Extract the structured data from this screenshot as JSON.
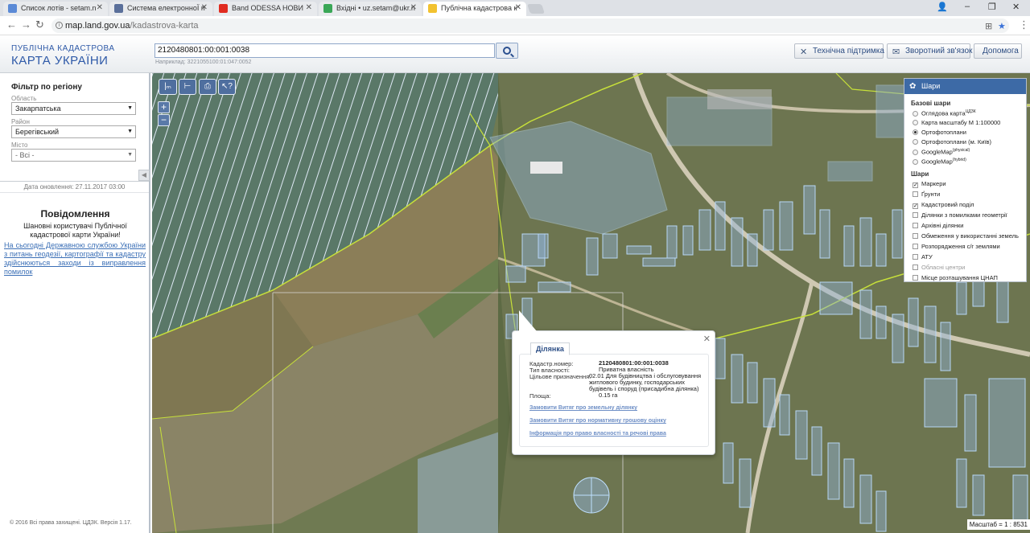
{
  "browser": {
    "tabs": [
      {
        "title": "Список лотів - setam.n",
        "favicon_color": "#5b8ad6"
      },
      {
        "title": "Система електронноЇ п",
        "favicon_color": "#5a6f9a"
      },
      {
        "title": "Band ODESSA НОВИ",
        "favicon_color": "#e02b20"
      },
      {
        "title": "Вхідні • uz.setam@ukr.n",
        "favicon_color": "#3aa757"
      },
      {
        "title": "Публічна кадастрова к",
        "favicon_color": "#f2c230"
      }
    ],
    "url_host": "map.land.gov.ua",
    "url_path": "/kadastrova-karta"
  },
  "header": {
    "logo_line1": "ПУБЛІЧНА КАДАСТРОВА",
    "logo_line2": "КАРТА УКРАЇНИ",
    "search_value": "2120480801:00:001:0038",
    "search_example": "Наприклад: 3221055100:01:047:0052",
    "buttons": {
      "support": "Технічна підтримка",
      "feedback": "Зворотний зв'язок",
      "help": "Допомога"
    }
  },
  "sidebar": {
    "filter_title": "Фільтр по регіону",
    "region_label": "Область",
    "region_value": "Закарпатська",
    "district_label": "Район",
    "district_value": "Берегівський",
    "city_label": "Місто",
    "city_value": "- Всі -",
    "update_date": "Дата оновлення: 27.11.2017 03:00",
    "notice_title": "Повідомлення",
    "notice_text": "Шановні користувачі Публічної кадастрової карти України!",
    "notice_link": "На сьогодні Державною службою України з питань геодезії, картографії та кадастру здійснюються заходи із виправлення помилок",
    "copyright": "© 2016 Всі права захищені. ЦДЗК. Версія 1.17."
  },
  "map": {
    "scale_text": "Масштаб = 1 : 8531",
    "tool_icons": [
      "ruler-line-icon",
      "ruler-area-icon",
      "print-icon",
      "info-cursor-icon"
    ]
  },
  "layers_panel": {
    "title": "Шари",
    "base_title": "Базові шари",
    "base_layers": [
      {
        "label": "Оглядова карта",
        "sup": "ЦДЗК",
        "selected": false
      },
      {
        "label": "Карта масштабу М 1:100000",
        "sup": "",
        "selected": false
      },
      {
        "label": "Ортофотоплани",
        "sup": "",
        "selected": true
      },
      {
        "label": "Ортофотоплани (м. Київ)",
        "sup": "",
        "selected": false
      },
      {
        "label": "GoogleMap",
        "sup": "(physical)",
        "selected": false
      },
      {
        "label": "GoogleMap",
        "sup": "(hybrid)",
        "selected": false
      }
    ],
    "overlay_title": "Шари",
    "overlay_layers": [
      {
        "label": "Маркери",
        "checked": true,
        "disabled": false
      },
      {
        "label": "Ґрунти",
        "checked": false,
        "disabled": false
      },
      {
        "label": "Кадастровий поділ",
        "checked": true,
        "disabled": false
      },
      {
        "label": "Ділянки з помилками геометрії",
        "checked": false,
        "disabled": false
      },
      {
        "label": "Архівні ділянки",
        "checked": false,
        "disabled": false
      },
      {
        "label": "Обмеження у використанні земель",
        "checked": false,
        "disabled": false
      },
      {
        "label": "Розпорядження с/г землями",
        "checked": false,
        "disabled": false
      },
      {
        "label": "АТУ",
        "checked": false,
        "disabled": false
      },
      {
        "label": "Обласні центри",
        "checked": false,
        "disabled": true
      },
      {
        "label": "Місце розташування ЦНАП",
        "checked": false,
        "disabled": false
      }
    ]
  },
  "popup": {
    "tab_label": "Ділянка",
    "cadastral_label": "Кадастр.номер:",
    "cadastral_value": "2120480801:00:001:0038",
    "ownership_label": "Тип власності:",
    "ownership_value": "Приватна власність",
    "purpose_label": "Цільове призначення:",
    "purpose_value": "02.01 Для будівництва і обслуговування житлового будинку, господарських будівель і споруд (присадибна ділянка)",
    "area_label": "Площа:",
    "area_value": "0.15 га",
    "link1": "Замовити Витяг про земельну ділянку",
    "link2": "Замовити Витяг про нормативну грошову оцінку",
    "link3": "Інформація про право власності та речові права"
  }
}
